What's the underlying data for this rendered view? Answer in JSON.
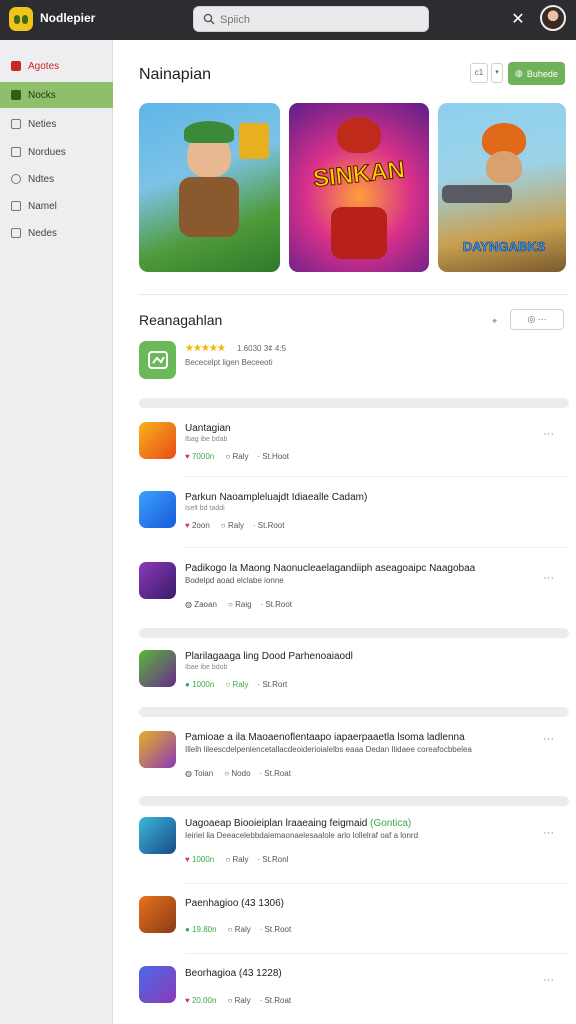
{
  "app": {
    "name": "Nodlepier"
  },
  "search": {
    "placeholder": "Spiich"
  },
  "sidebar": {
    "items": [
      {
        "label": "Agotes"
      },
      {
        "label": "Nocks"
      },
      {
        "label": "Neties"
      },
      {
        "label": "Nordues"
      },
      {
        "label": "Ndtes"
      },
      {
        "label": "Namel"
      },
      {
        "label": "Nedes"
      }
    ]
  },
  "page": {
    "title": "Nainapian"
  },
  "toolbar": {
    "count_label": "c1",
    "dropdown_label": "▾",
    "green_button_label": "Buhede"
  },
  "banners": [
    {
      "title": ""
    },
    {
      "title": "SINKAN"
    },
    {
      "title": "DAYNGABKS"
    }
  ],
  "section": {
    "title": "Reanagahlan",
    "action_label": "⌖",
    "button_label": "◎ ···"
  },
  "featured": {
    "stars": "★★★★★",
    "meta": "1.6030 3¢ 4:5",
    "sub": "Bececelpt ligen Beceeoti"
  },
  "colors": {
    "accent": "#6fb25a",
    "sidebar_active": "#8fbf6a",
    "star": "#f2b400",
    "heart": "#d93a4a"
  },
  "apps": [
    {
      "title": "Uantagian",
      "title_tag": "",
      "desc": "Ibag ibe bdab",
      "icon": "heart",
      "meta1": "7000n",
      "meta2": "Raly",
      "meta3": "St.Hoot"
    },
    {
      "title": "Parkun Naoampleluajdt Idiaealle Cadam)",
      "title_tag": "",
      "desc": "Iselt bd taddi",
      "icon": "heart",
      "meta1": "2oon",
      "meta2": "Raly",
      "meta3": "St.Root"
    },
    {
      "title": "Padikogo la Maong Naonucleaelagandiiph aseagoaipc Naagobaa",
      "title_tag": "",
      "desc": "Bodelpd aoad elclabe ionne",
      "icon": "circle",
      "meta1": "Zaoan",
      "meta2": "Raig",
      "meta3": "St.Root"
    },
    {
      "title": "Plarilagaaga ling Dood Parhenoaiaodl",
      "title_tag": "",
      "desc": "Ibae ibe bdob",
      "icon": "gcircle",
      "meta1": "1000n",
      "meta2": "Raly",
      "meta3": "St.Rort"
    },
    {
      "title": "Pamioae a ila Maoaenoflentaapo iapaerpaaetla lsoma ladlenna",
      "title_tag": "",
      "desc": "Illelh lileescdelpenlencetallacdeoiderioialelbs eaaa Dedan Ilidaee coreafocbbelea",
      "icon": "circle",
      "meta1": "Toian",
      "meta2": "Nodo",
      "meta3": "St.Roat"
    },
    {
      "title": "Uagoaeap Biooieiplan lraaeaing feigmaid",
      "title_tag": "(Gontica)",
      "desc": "Ieiriel lia Deeacelebbdaiemaonaelesaalole arlo lollelraf oaf a lonrd",
      "icon": "heart",
      "meta1": "1000n",
      "meta2": "Raly",
      "meta3": "St.Ronl"
    },
    {
      "title": "Paenhagioo (43 1306)",
      "title_tag": "",
      "desc": "",
      "icon": "gcircle",
      "meta1": "19.80n",
      "meta2": "Raly",
      "meta3": "St.Root"
    },
    {
      "title": "Beorhagioa (43 1228)",
      "title_tag": "",
      "desc": "",
      "icon": "heart",
      "meta1": "20.00n",
      "meta2": "Raly",
      "meta3": "St.Roat"
    }
  ]
}
